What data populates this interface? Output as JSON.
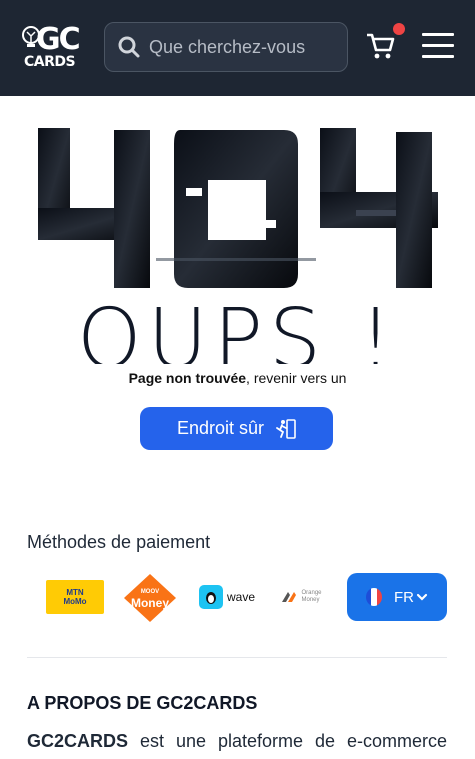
{
  "header": {
    "logo_top": "GC",
    "logo_bottom": "CARDS",
    "search_placeholder": "Que cherchez-vous",
    "cart_icon": "cart-icon",
    "menu_icon": "hamburger-icon"
  },
  "error": {
    "code": "404",
    "headline": "OUPS !",
    "message_bold": "Page non trouvée",
    "message_rest": ", revenir vers un",
    "button_label": "Endroit sûr",
    "button_icon": "running-person-icon"
  },
  "payments": {
    "title": "Méthodes de paiement",
    "methods": [
      {
        "name": "MTN MoMo",
        "label_top": "MTN",
        "label_bottom": "MoMo"
      },
      {
        "name": "Moov Money",
        "label_top": "MOOV",
        "label_bottom": "Money"
      },
      {
        "name": "Wave",
        "label": "wave"
      },
      {
        "name": "Orange Money",
        "label_top": "Orange",
        "label_bottom": "Money"
      }
    ],
    "language": "FR"
  },
  "about": {
    "title": "A PROPOS DE GC2CARDS",
    "brand": "GC2CARDS",
    "text": " est une plateforme de e-commerce"
  },
  "colors": {
    "header_bg": "#1e2633",
    "primary_button": "#2563eb",
    "language_button": "#1a73e8",
    "cart_badge": "#ef4444"
  }
}
